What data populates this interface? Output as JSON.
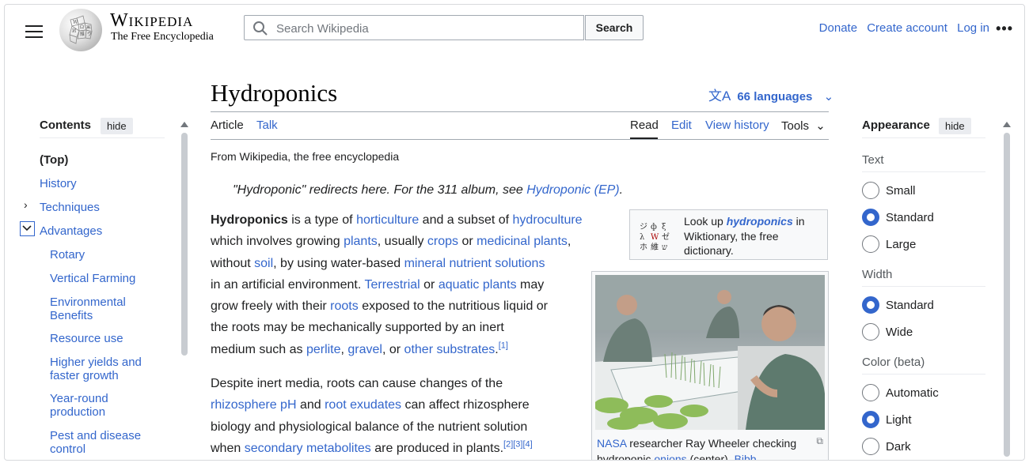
{
  "header": {
    "wordmark": "Wikipedia",
    "tagline": "The Free Encyclopedia",
    "search_placeholder": "Search Wikipedia",
    "search_button": "Search",
    "links": {
      "donate": "Donate",
      "create_account": "Create account",
      "login": "Log in"
    },
    "more": "•••"
  },
  "toc": {
    "title": "Contents",
    "hide": "hide",
    "items": {
      "top": "(Top)",
      "history": "History",
      "techniques": "Techniques",
      "advantages": "Advantages",
      "rotary": "Rotary",
      "vertical_farming": "Vertical Farming",
      "environmental_benefits": "Environmental Benefits",
      "resource_use": "Resource use",
      "higher_yields": "Higher yields and faster growth",
      "year_round": "Year-round production",
      "pest_disease": "Pest and disease control"
    }
  },
  "article": {
    "title": "Hydroponics",
    "languages": "66 languages",
    "tabs": {
      "article": "Article",
      "talk": "Talk",
      "read": "Read",
      "edit": "Edit",
      "view_history": "View history",
      "tools": "Tools"
    },
    "from": "From Wikipedia, the free encyclopedia",
    "hatnote_text": "\"Hydroponic\" redirects here. For the 311 album, see ",
    "hatnote_link": "Hydroponic (EP)",
    "wiktionary": {
      "pre": "Look up ",
      "word": "hydroponics",
      "post": " in Wiktionary, the free dictionary."
    },
    "caption": {
      "nasa": "NASA",
      "text1": " researcher Ray Wheeler checking hydroponic ",
      "onions": "onions",
      "text2": " (center), ",
      "bibb": "Bibb"
    }
  },
  "appearance": {
    "title": "Appearance",
    "hide": "hide",
    "text_label": "Text",
    "text_options": [
      "Small",
      "Standard",
      "Large"
    ],
    "text_selected": "Standard",
    "width_label": "Width",
    "width_options": [
      "Standard",
      "Wide"
    ],
    "width_selected": "Standard",
    "color_label": "Color (beta)",
    "color_options": [
      "Automatic",
      "Light",
      "Dark"
    ],
    "color_selected": "Light"
  },
  "colors": {
    "link": "#3366cc",
    "text": "#202122",
    "accent": "#3366cc",
    "border": "#a2a9b1"
  }
}
